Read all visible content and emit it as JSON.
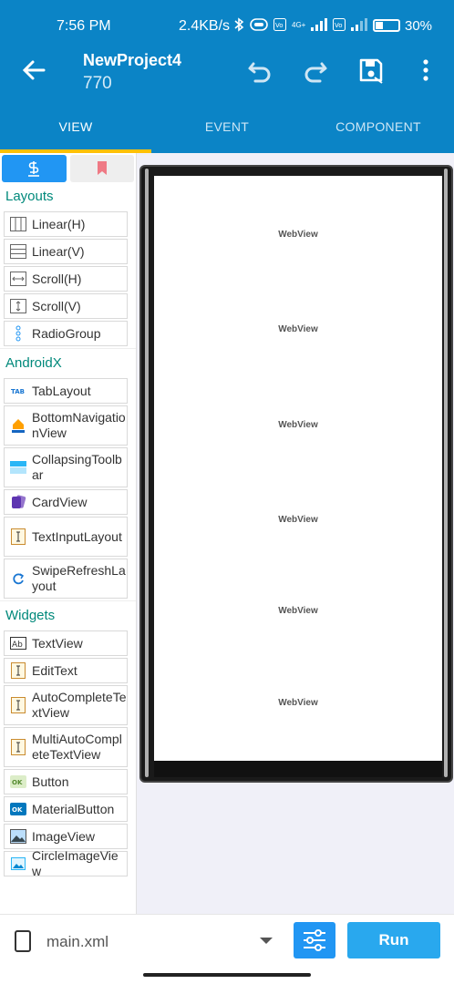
{
  "status": {
    "time": "7:56 PM",
    "speed": "2.4KB/s",
    "net_label": "4G+",
    "battery": "30%"
  },
  "appbar": {
    "title": "NewProject4",
    "subtitle": "770"
  },
  "tabs": [
    "VIEW",
    "EVENT",
    "COMPONENT"
  ],
  "palette": {
    "sections": {
      "layouts": "Layouts",
      "androidx": "AndroidX",
      "widgets": "Widgets"
    },
    "layouts": [
      "Linear(H)",
      "Linear(V)",
      "Scroll(H)",
      "Scroll(V)",
      "RadioGroup"
    ],
    "androidx": [
      "TabLayout",
      "BottomNavigationView",
      "CollapsingToolbar",
      "CardView",
      "TextInputLayout",
      "SwipeRefreshLayout"
    ],
    "widgets": [
      "TextView",
      "EditText",
      "AutoCompleteTextView",
      "MultiAutoCompleteTextView",
      "Button",
      "MaterialButton",
      "ImageView",
      "CircleImageView"
    ]
  },
  "canvas": {
    "webviews": [
      "WebView",
      "WebView",
      "WebView",
      "WebView",
      "WebView",
      "WebView"
    ]
  },
  "bottom": {
    "file": "main.xml",
    "run": "Run"
  }
}
